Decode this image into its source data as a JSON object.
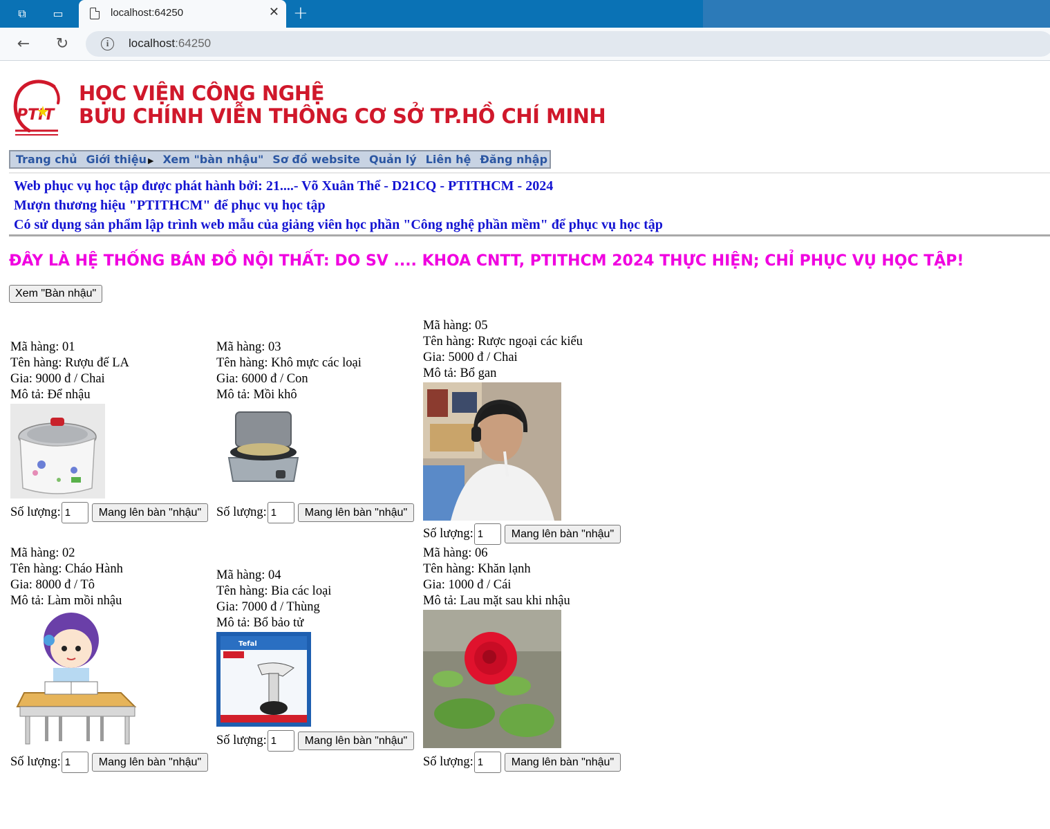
{
  "browser": {
    "tab_title": "localhost:64250",
    "url_host": "localhost",
    "url_port": ":64250"
  },
  "header": {
    "logo_text": "PTIT",
    "brand_line1": "HỌC VIỆN CÔNG NGHỆ",
    "brand_line2": "BƯU CHÍNH VIỄN THÔNG CƠ SỞ TP.HỒ CHÍ MINH"
  },
  "menu": {
    "items": [
      "Trang chủ",
      "Giới thiệu",
      "Xem \"bàn nhậu\"",
      "Sơ đồ website",
      "Quản lý",
      "Liên hệ",
      "Đăng nhập"
    ]
  },
  "notice": {
    "line1": "Web phục vụ học tập được phát hành bởi: 21....- Võ Xuân Thể - D21CQ - PTITHCM - 2024",
    "line2": "Mượn thương hiệu \"PTITHCM\" để phục vụ học tập",
    "line3": "Có sử dụng sản phẩm lập trình web mẫu của giảng viên học phần \"Công nghệ phần mềm\" để phục vụ học tập"
  },
  "headline": "ĐÂY LÀ HỆ THỐNG BÁN ĐỒ NỘI THẤT: DO SV .... KHOA CNTT, PTITHCM 2024 THỰC HIỆN; CHỈ PHỤC VỤ HỌC TẬP!",
  "view_cart_button": "Xem \"Bàn nhậu\"",
  "qty_label": "Số lượng:",
  "add_button": "Mang lên bàn \"nhậu\"",
  "products": [
    {
      "code": "Mã hàng: 01",
      "name": "Tên hàng: Rượu đế LA",
      "price": "Gia: 9000  đ / Chai",
      "desc": "Mô tả: Để nhậu",
      "qty": "1"
    },
    {
      "code": "Mã hàng: 03",
      "name": "Tên hàng: Khô mực các loại",
      "price": "Gia: 6000  đ / Con",
      "desc": "Mô tả: Mồi khô",
      "qty": "1"
    },
    {
      "code": "Mã hàng: 05",
      "name": "Tên hàng: Rược ngoại các kiểu",
      "price": "Gia: 5000  đ / Chai",
      "desc": "Mô tả: Bổ gan",
      "qty": "1"
    },
    {
      "code": "Mã hàng: 02",
      "name": "Tên hàng: Cháo Hành",
      "price": "Gia: 8000  đ / Tô",
      "desc": "Mô tả: Làm mồi nhậu",
      "qty": "1"
    },
    {
      "code": "Mã hàng: 04",
      "name": "Tên hàng: Bia các loại",
      "price": "Gia: 7000  đ / Thùng",
      "desc": "Mô tả: Bổ bảo tử",
      "qty": "1"
    },
    {
      "code": "Mã hàng: 06",
      "name": "Tên hàng: Khăn lạnh",
      "price": "Gia: 1000  đ / Cái",
      "desc": "Mô tả: Lau mặt sau khi nhậu",
      "qty": "1"
    }
  ],
  "product_images": {
    "p4_brand_text": "Tefal"
  },
  "colors": {
    "brand_red": "#d0182b",
    "menu_blue": "#2b56a2",
    "notice_blue": "#1414d2",
    "headline_magenta": "#f000e0"
  }
}
